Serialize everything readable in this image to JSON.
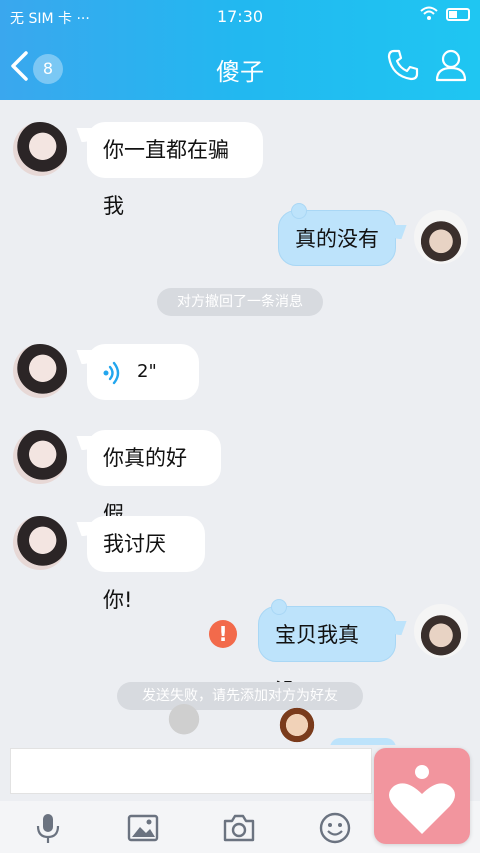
{
  "statusbar": {
    "carrier": "无 SIM 卡 ···",
    "time": "17:30"
  },
  "navbar": {
    "back_count": "8",
    "title": "傻子"
  },
  "messages": [
    {
      "side": "left",
      "text": "你一直都在骗我"
    },
    {
      "side": "right",
      "text": "真的没有"
    },
    {
      "side": "notice",
      "text": "对方撤回了一条消息"
    },
    {
      "side": "left",
      "type": "voice",
      "text": "2\""
    },
    {
      "side": "left",
      "text": "你真的好假"
    },
    {
      "side": "left",
      "text": "我讨厌你!"
    },
    {
      "side": "right",
      "text": "宝贝我真没",
      "failed": true
    },
    {
      "side": "notice",
      "text": "发送失败，请先添加对方为好友"
    }
  ],
  "error_mark": "!",
  "input": {
    "value": "",
    "placeholder": ""
  },
  "toolbar": {
    "items": [
      "microphone-icon",
      "image-icon",
      "camera-icon",
      "emoji-icon"
    ]
  },
  "colors": {
    "header_start": "#3aa7ee",
    "header_end": "#1fc6f2",
    "bubble_right": "#bde3fb",
    "error": "#f26a4b",
    "heart_button": "#f2959e"
  }
}
